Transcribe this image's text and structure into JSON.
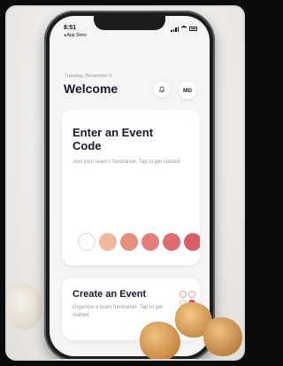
{
  "status_bar": {
    "time": "8:51",
    "back_label": "◂ App Store"
  },
  "header": {
    "date": "Tuesday, November 5",
    "title": "Welcome",
    "avatar_initials": "MD"
  },
  "event_code_card": {
    "title": "Enter an Event Code",
    "subtitle": "Join your team's fundraiser. Tap to get started",
    "dots": [
      {
        "color": "#ffffff",
        "outlined": true
      },
      {
        "color": "#f0b89c",
        "outlined": false
      },
      {
        "color": "#e7907d",
        "outlined": false
      },
      {
        "color": "#e57e76",
        "outlined": false
      },
      {
        "color": "#df6b70",
        "outlined": false
      },
      {
        "color": "#db5c68",
        "outlined": false
      }
    ]
  },
  "create_event_card": {
    "title": "Create an Event",
    "subtitle": "Organize a team fundraiser. Tap to get started",
    "icon_colors": [
      "#f0a58a",
      "#f0a58a",
      "#f3c4a0",
      "#d7505f"
    ]
  },
  "colors": {
    "accent": "#e57e76",
    "background": "#f5f5f6",
    "text_dark": "#1a1a2e"
  }
}
